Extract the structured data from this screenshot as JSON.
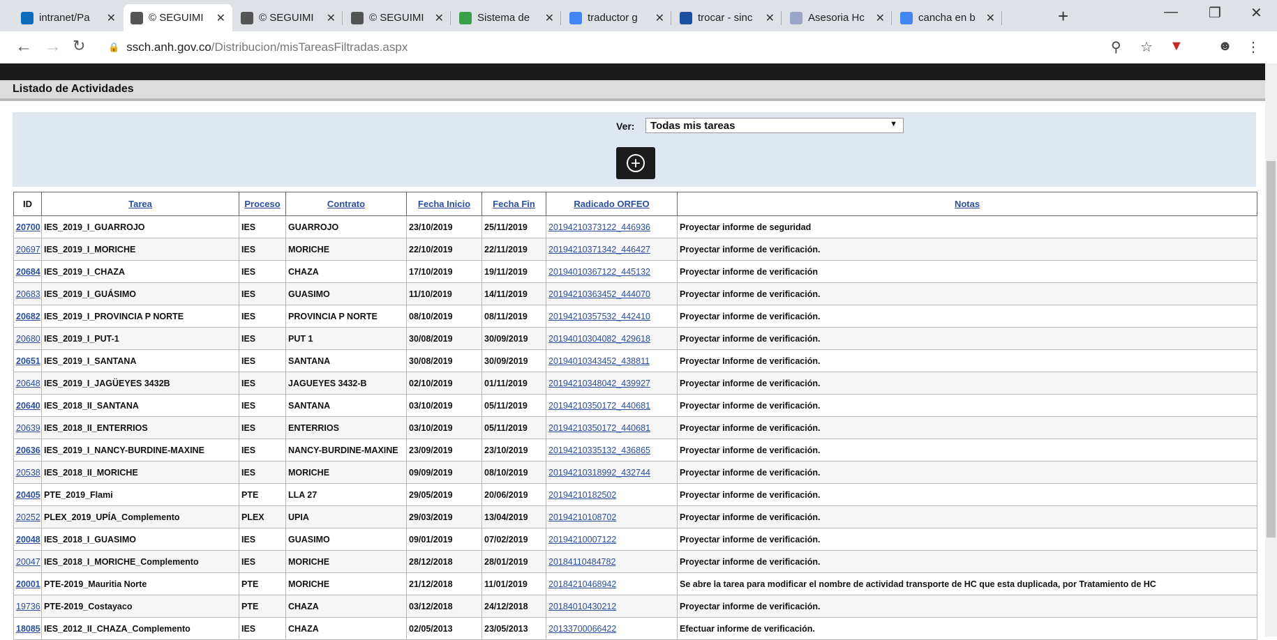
{
  "browser": {
    "tabs": [
      {
        "label": "intranet/Pa",
        "icon": "sharepoint-icon",
        "color": "#0b6cbd"
      },
      {
        "label": "© SEGUIMI",
        "icon": "globe-icon",
        "color": "#555555"
      },
      {
        "label": "© SEGUIMI",
        "icon": "globe-icon",
        "color": "#555555"
      },
      {
        "label": "© SEGUIMI",
        "icon": "globe-icon",
        "color": "#555555"
      },
      {
        "label": "Sistema de",
        "icon": "leaf-icon",
        "color": "#3aa04a"
      },
      {
        "label": "traductor g",
        "icon": "google-icon",
        "color": "#4285f4"
      },
      {
        "label": "trocar - sinc",
        "icon": "wordreference-icon",
        "color": "#1a4fa0"
      },
      {
        "label": "Asesoria Hc",
        "icon": "site-icon",
        "color": "#9aa6c8"
      },
      {
        "label": "cancha en b",
        "icon": "google-icon",
        "color": "#4285f4"
      }
    ],
    "url_host": "ssch.anh.gov.co",
    "url_path": "/Distribucion/misTareasFiltradas.aspx"
  },
  "page": {
    "header_title": "Listado de Actividades",
    "filter_label": "Ver:",
    "filter_value": "Todas mis tareas"
  },
  "table": {
    "headers": {
      "id": "ID",
      "tarea": "Tarea",
      "proceso": "Proceso",
      "contrato": "Contrato",
      "fecha_inicio": "Fecha Inicio",
      "fecha_fin": "Fecha Fin",
      "radicado": "Radicado ORFEO",
      "notas": "Notas"
    },
    "rows": [
      {
        "id": "20700",
        "tarea": "IES_2019_I_GUARROJO",
        "proceso": "IES",
        "contrato": "GUARROJO",
        "inicio": "23/10/2019",
        "fin": "25/11/2019",
        "radicado": "20194210373122_446936",
        "notas": "Proyectar informe de seguridad"
      },
      {
        "id": "20697",
        "tarea": "IES_2019_I_MORICHE",
        "proceso": "IES",
        "contrato": "MORICHE",
        "inicio": "22/10/2019",
        "fin": "22/11/2019",
        "radicado": "20194210371342_446427",
        "notas": "Proyectar informe de verificación."
      },
      {
        "id": "20684",
        "tarea": "IES_2019_I_CHAZA",
        "proceso": "IES",
        "contrato": "CHAZA",
        "inicio": "17/10/2019",
        "fin": "19/11/2019",
        "radicado": "20194010367122_445132",
        "notas": "Proyectar informe de verificación"
      },
      {
        "id": "20683",
        "tarea": "IES_2019_I_GUÁSIMO",
        "proceso": "IES",
        "contrato": "GUASIMO",
        "inicio": "11/10/2019",
        "fin": "14/11/2019",
        "radicado": "20194210363452_444070",
        "notas": "Proyectar informe de verificación."
      },
      {
        "id": "20682",
        "tarea": "IES_2019_I_PROVINCIA P NORTE",
        "proceso": "IES",
        "contrato": "PROVINCIA P NORTE",
        "inicio": "08/10/2019",
        "fin": "08/11/2019",
        "radicado": "20194210357532_442410",
        "notas": "Proyectar informe de verificación."
      },
      {
        "id": "20680",
        "tarea": "IES_2019_I_PUT-1",
        "proceso": "IES",
        "contrato": "PUT 1",
        "inicio": "30/08/2019",
        "fin": "30/09/2019",
        "radicado": "20194010304082_429618",
        "notas": "Proyectar informe de verificación."
      },
      {
        "id": "20651",
        "tarea": "IES_2019_I_SANTANA",
        "proceso": "IES",
        "contrato": "SANTANA",
        "inicio": "30/08/2019",
        "fin": "30/09/2019",
        "radicado": "20194010343452_438811",
        "notas": "Proyectar Informe de verificación."
      },
      {
        "id": "20648",
        "tarea": "IES_2019_I_JAGÜEYES 3432B",
        "proceso": "IES",
        "contrato": "JAGUEYES 3432-B",
        "inicio": "02/10/2019",
        "fin": "01/11/2019",
        "radicado": "20194210348042_439927",
        "notas": "Proyectar informe de verificación."
      },
      {
        "id": "20640",
        "tarea": "IES_2018_II_SANTANA",
        "proceso": "IES",
        "contrato": "SANTANA",
        "inicio": "03/10/2019",
        "fin": "05/11/2019",
        "radicado": "20194210350172_440681",
        "notas": "Proyectar informe de verificación."
      },
      {
        "id": "20639",
        "tarea": "IES_2018_II_ENTERRIOS",
        "proceso": "IES",
        "contrato": "ENTERRIOS",
        "inicio": "03/10/2019",
        "fin": "05/11/2019",
        "radicado": "20194210350172_440681",
        "notas": "Proyectar informe de verificación."
      },
      {
        "id": "20636",
        "tarea": "IES_2019_I_NANCY-BURDINE-MAXINE",
        "proceso": "IES",
        "contrato": "NANCY-BURDINE-MAXINE",
        "inicio": "23/09/2019",
        "fin": "23/10/2019",
        "radicado": "20194210335132_436865",
        "notas": "Proyectar informe de verificación."
      },
      {
        "id": "20538",
        "tarea": "IES_2018_II_MORICHE",
        "proceso": "IES",
        "contrato": "MORICHE",
        "inicio": "09/09/2019",
        "fin": "08/10/2019",
        "radicado": "20194210318992_432744",
        "notas": "Proyectar informe de verificación."
      },
      {
        "id": "20405",
        "tarea": "PTE_2019_Flami",
        "proceso": "PTE",
        "contrato": "LLA 27",
        "inicio": "29/05/2019",
        "fin": "20/06/2019",
        "radicado": "20194210182502",
        "notas": "Proyectar informe de verificación."
      },
      {
        "id": "20252",
        "tarea": "PLEX_2019_UPÍA_Complemento",
        "proceso": "PLEX",
        "contrato": "UPIA",
        "inicio": "29/03/2019",
        "fin": "13/04/2019",
        "radicado": "20194210108702",
        "notas": "Proyectar informe de verificación."
      },
      {
        "id": "20048",
        "tarea": "IES_2018_I_GUASIMO",
        "proceso": "IES",
        "contrato": "GUASIMO",
        "inicio": "09/01/2019",
        "fin": "07/02/2019",
        "radicado": "20194210007122",
        "notas": "Proyectar informe de verificación."
      },
      {
        "id": "20047",
        "tarea": "IES_2018_I_MORICHE_Complemento",
        "proceso": "IES",
        "contrato": "MORICHE",
        "inicio": "28/12/2018",
        "fin": "28/01/2019",
        "radicado": "20184110484782",
        "notas": "Proyectar informe de verificación."
      },
      {
        "id": "20001",
        "tarea": "PTE-2019_Mauritia Norte",
        "proceso": "PTE",
        "contrato": "MORICHE",
        "inicio": "21/12/2018",
        "fin": "11/01/2019",
        "radicado": "20184210468942",
        "notas": "Se abre la tarea para modificar el nombre de actividad transporte de HC que esta duplicada, por Tratamiento de HC"
      },
      {
        "id": "19736",
        "tarea": "PTE-2019_Costayaco",
        "proceso": "PTE",
        "contrato": "CHAZA",
        "inicio": "03/12/2018",
        "fin": "24/12/2018",
        "radicado": "20184010430212",
        "notas": "Proyectar informe de verificación."
      },
      {
        "id": "18085",
        "tarea": "IES_2012_II_CHAZA_Complemento",
        "proceso": "IES",
        "contrato": "CHAZA",
        "inicio": "02/05/2013",
        "fin": "23/05/2013",
        "radicado": "20133700066422",
        "notas": "Efectuar informe de verificación."
      }
    ]
  },
  "colors": {
    "link": "#2a4f9c",
    "panel": "#dfe7f1",
    "navbar": "#1b1b1b"
  }
}
